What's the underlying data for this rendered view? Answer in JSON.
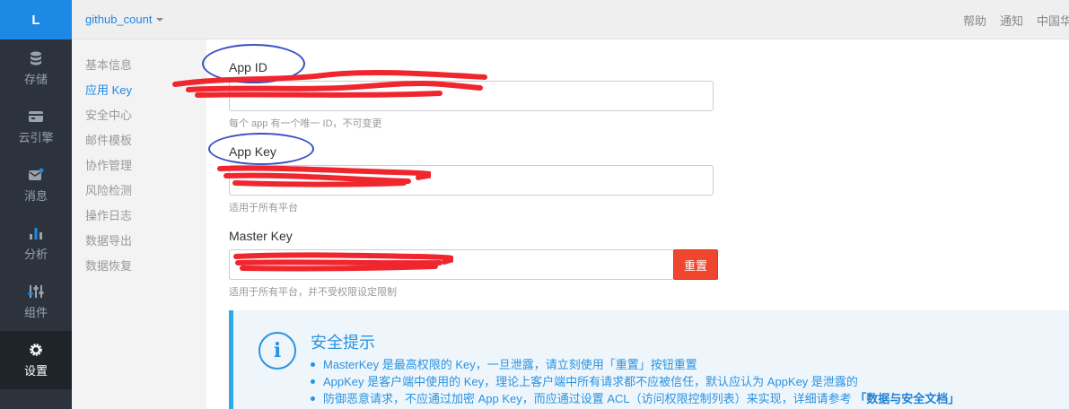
{
  "rail": {
    "logo": "L",
    "items": [
      {
        "label": "存储",
        "icon": "database-icon"
      },
      {
        "label": "云引擎",
        "icon": "cloud-engine-icon"
      },
      {
        "label": "消息",
        "icon": "mail-icon"
      },
      {
        "label": "分析",
        "icon": "bar-chart-icon"
      },
      {
        "label": "组件",
        "icon": "sliders-icon"
      },
      {
        "label": "设置",
        "icon": "gear-icon"
      }
    ],
    "active": "设置"
  },
  "topbar": {
    "app_name": "github_count",
    "links": [
      "帮助",
      "通知",
      "中国华北"
    ]
  },
  "subnav": {
    "items": [
      "基本信息",
      "应用 Key",
      "安全中心",
      "邮件模板",
      "协作管理",
      "风险检测",
      "操作日志",
      "数据导出",
      "数据恢复"
    ],
    "active": "应用 Key"
  },
  "fields": {
    "app_id": {
      "label": "App ID",
      "value": "",
      "help": "每个 app 有一个唯一 ID，不可变更"
    },
    "app_key": {
      "label": "App Key",
      "value": "",
      "help": "适用于所有平台"
    },
    "master_key": {
      "label": "Master Key",
      "value": "",
      "help": "适用于所有平台，并不受权限设定限制",
      "reset_label": "重置"
    }
  },
  "alert": {
    "icon": "info-icon",
    "title": "安全提示",
    "items": [
      "MasterKey 是最高权限的 Key，一旦泄露，请立刻使用「重置」按钮重置",
      "AppKey 是客户端中使用的 Key，理论上客户端中所有请求都不应被信任，默认应认为 AppKey 是泄露的",
      "防御恶意请求，不应通过加密 App Key，而应通过设置 ACL（访问权限控制列表）来实现，详细请参考 "
    ],
    "link": "「数据与安全文档」"
  },
  "colors": {
    "accent": "#1e88e5",
    "rail_bg": "#2d333c",
    "danger": "#f0462d",
    "annotation_circle": "#3a4fc4",
    "redaction": "#f0262e"
  }
}
